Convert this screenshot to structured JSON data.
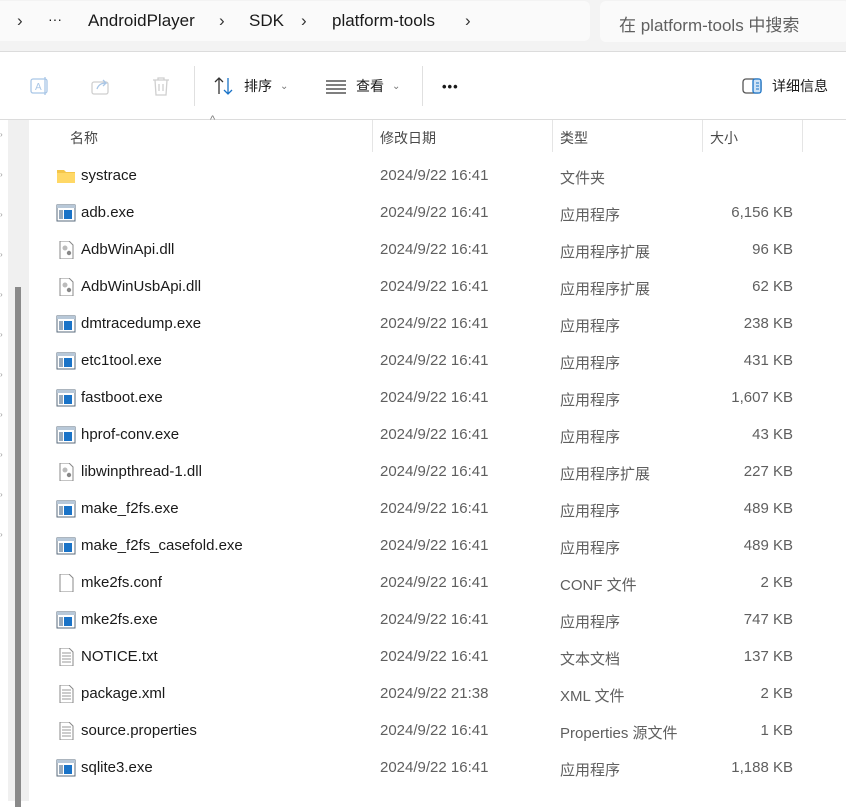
{
  "breadcrumb": {
    "items": [
      "AndroidPlayer",
      "SDK",
      "platform-tools"
    ],
    "overflow": "···"
  },
  "search": {
    "placeholder": "在 platform-tools 中搜索"
  },
  "toolbar": {
    "sort_label": "排序",
    "view_label": "查看",
    "more": "•••",
    "details_label": "详细信息"
  },
  "columns": {
    "name": "名称",
    "date": "修改日期",
    "type": "类型",
    "size": "大小"
  },
  "files": [
    {
      "name": "systrace",
      "date": "2024/9/22 16:41",
      "type": "文件夹",
      "size": "",
      "icon": "folder"
    },
    {
      "name": "adb.exe",
      "date": "2024/9/22 16:41",
      "type": "应用程序",
      "size": "6,156 KB",
      "icon": "exe"
    },
    {
      "name": "AdbWinApi.dll",
      "date": "2024/9/22 16:41",
      "type": "应用程序扩展",
      "size": "96 KB",
      "icon": "dll"
    },
    {
      "name": "AdbWinUsbApi.dll",
      "date": "2024/9/22 16:41",
      "type": "应用程序扩展",
      "size": "62 KB",
      "icon": "dll"
    },
    {
      "name": "dmtracedump.exe",
      "date": "2024/9/22 16:41",
      "type": "应用程序",
      "size": "238 KB",
      "icon": "exe"
    },
    {
      "name": "etc1tool.exe",
      "date": "2024/9/22 16:41",
      "type": "应用程序",
      "size": "431 KB",
      "icon": "exe"
    },
    {
      "name": "fastboot.exe",
      "date": "2024/9/22 16:41",
      "type": "应用程序",
      "size": "1,607 KB",
      "icon": "exe"
    },
    {
      "name": "hprof-conv.exe",
      "date": "2024/9/22 16:41",
      "type": "应用程序",
      "size": "43 KB",
      "icon": "exe"
    },
    {
      "name": "libwinpthread-1.dll",
      "date": "2024/9/22 16:41",
      "type": "应用程序扩展",
      "size": "227 KB",
      "icon": "dll"
    },
    {
      "name": "make_f2fs.exe",
      "date": "2024/9/22 16:41",
      "type": "应用程序",
      "size": "489 KB",
      "icon": "exe"
    },
    {
      "name": "make_f2fs_casefold.exe",
      "date": "2024/9/22 16:41",
      "type": "应用程序",
      "size": "489 KB",
      "icon": "exe"
    },
    {
      "name": "mke2fs.conf",
      "date": "2024/9/22 16:41",
      "type": "CONF 文件",
      "size": "2 KB",
      "icon": "blank"
    },
    {
      "name": "mke2fs.exe",
      "date": "2024/9/22 16:41",
      "type": "应用程序",
      "size": "747 KB",
      "icon": "exe"
    },
    {
      "name": "NOTICE.txt",
      "date": "2024/9/22 16:41",
      "type": "文本文档",
      "size": "137 KB",
      "icon": "text"
    },
    {
      "name": "package.xml",
      "date": "2024/9/22 21:38",
      "type": "XML 文件",
      "size": "2 KB",
      "icon": "text"
    },
    {
      "name": "source.properties",
      "date": "2024/9/22 16:41",
      "type": "Properties 源文件",
      "size": "1 KB",
      "icon": "text"
    },
    {
      "name": "sqlite3.exe",
      "date": "2024/9/22 16:41",
      "type": "应用程序",
      "size": "1,188 KB",
      "icon": "exe"
    }
  ]
}
